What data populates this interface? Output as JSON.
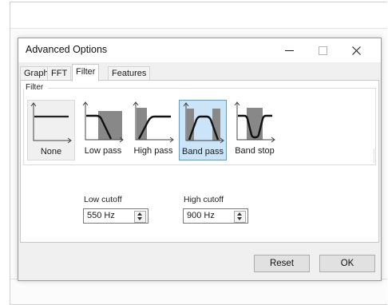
{
  "window": {
    "title": "Advanced Options",
    "controls": [
      "minimize",
      "maximize",
      "close"
    ]
  },
  "tabs": [
    {
      "label": "Graph",
      "active": false
    },
    {
      "label": "FFT",
      "active": false
    },
    {
      "label": "Filter",
      "active": true
    },
    {
      "label": "Features",
      "active": false
    }
  ],
  "filter_group": {
    "label": "Filter",
    "options": [
      {
        "label": "None",
        "icon": "filter-none-icon",
        "selected": false
      },
      {
        "label": "Low pass",
        "icon": "low-pass-icon",
        "selected": false
      },
      {
        "label": "High pass",
        "icon": "high-pass-icon",
        "selected": false
      },
      {
        "label": "Band pass",
        "icon": "band-pass-icon",
        "selected": true
      },
      {
        "label": "Band stop",
        "icon": "band-stop-icon",
        "selected": false
      }
    ]
  },
  "cutoffs": {
    "low": {
      "label": "Low cutoff",
      "value": "550 Hz"
    },
    "high": {
      "label": "High cutoff",
      "value": "900 Hz"
    }
  },
  "buttons": {
    "reset": "Reset",
    "ok": "OK"
  },
  "colors": {
    "selected_fill": "#cce4f7",
    "selected_border": "#56a0d8",
    "band_gray": "#888888"
  }
}
